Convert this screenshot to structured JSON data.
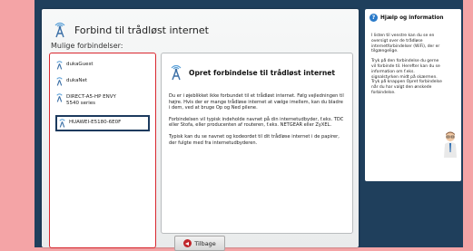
{
  "dialog": {
    "title": "Forbind til trådløst internet",
    "subtitle": "Mulige forbindelser:"
  },
  "networks": [
    {
      "name": "dukaGuest",
      "selected": false
    },
    {
      "name": "dukaNet",
      "selected": false
    },
    {
      "name": "DIRECT-A5-HP ENVY 5540 series",
      "selected": false
    },
    {
      "name": "HUAWEI-E5180-6E0F",
      "selected": true
    }
  ],
  "info": {
    "title": "Opret forbindelse til trådløst internet",
    "p1": "Du er i øjeblikket ikke forbundet til et trådløst internet. Følg vejledningen til højre. Hvis der er mange trådløse internet at vælge imellem, kan du bladre i dem, ved at bruge Op og Ned pilene.",
    "p2": "Forbindelsen vil typisk indeholde navnet på din internetudbyder, f.eks. TDC eller Stofa, eller producenten af routeren, f.eks. NETGEAR eller ZyXEL.",
    "p3": "Typisk kan du se navnet og kodeordet til dit trådløse internet i de papirer, der fulgte med fra internetudbyderen."
  },
  "back_button": "Tilbage",
  "help": {
    "title": "Hjælp og information",
    "p1": "I listen til venstre kan du se en oversigt over de trådløse internetforbindelser (WiFi), der er tilgængelige.",
    "p2": "Tryk på den forbindelse du gerne vil forbinde til. Herefter kan du se information om f.eks. signalstyrken midt på skærmen. Tryk på knappen Opret forbindelse når du har valgt den ønskede forbindelse."
  },
  "colors": {
    "background": "#f4a4a6",
    "frame": "#1f3f5c",
    "list_border": "#d9272e",
    "selected_border": "#1c3a5e",
    "help_icon": "#2a7ac9"
  }
}
